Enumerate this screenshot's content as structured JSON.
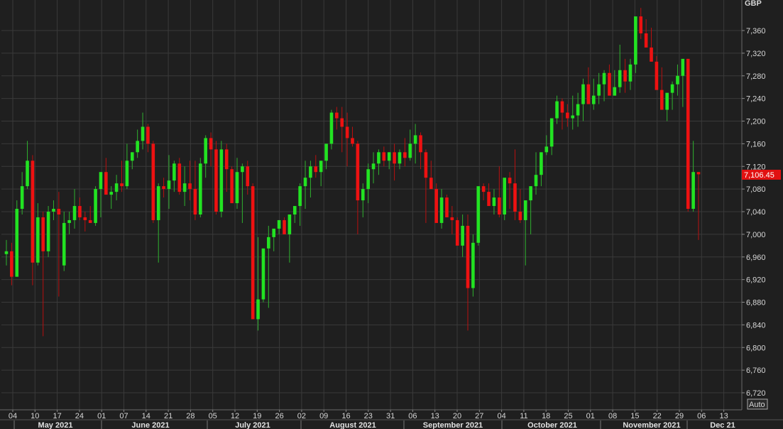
{
  "chart_data": {
    "type": "candlestick",
    "currency_label": "GBP",
    "last_price_label": "7,106.45",
    "auto_label": "Auto",
    "ylim": [
      6700,
      7400
    ],
    "y_ticks": [
      6720,
      6760,
      6800,
      6840,
      6880,
      6920,
      6960,
      7000,
      7040,
      7080,
      7120,
      7160,
      7200,
      7240,
      7280,
      7320,
      7360
    ],
    "y_tick_labels": [
      "6,720",
      "6,760",
      "6,800",
      "6,840",
      "6,880",
      "6,920",
      "6,960",
      "7,000",
      "7,040",
      "7,080",
      "7,120",
      "7,160",
      "7,200",
      "7,240",
      "7,280",
      "7,320",
      "7,360"
    ],
    "x_day_labels": [
      "04",
      "10",
      "17",
      "24",
      "01",
      "07",
      "14",
      "21",
      "28",
      "05",
      "12",
      "19",
      "26",
      "02",
      "09",
      "16",
      "23",
      "31",
      "06",
      "13",
      "20",
      "27",
      "04",
      "11",
      "18",
      "25",
      "01",
      "08",
      "15",
      "22",
      "29",
      "06",
      "13"
    ],
    "month_labels": [
      "May 2021",
      "June 2021",
      "July 2021",
      "August 2021",
      "September 2021",
      "October 2021",
      "November 2021",
      "Dec 21"
    ],
    "up_color": "#22e322",
    "down_color": "#ee1111",
    "background": "#1f1f1f",
    "candles": [
      [
        6965,
        6990,
        6945,
        6970
      ],
      [
        6970,
        6985,
        6910,
        6925
      ],
      [
        6925,
        7060,
        6925,
        7045
      ],
      [
        7045,
        7110,
        7035,
        7085
      ],
      [
        7085,
        7165,
        7080,
        7130
      ],
      [
        7130,
        7140,
        6910,
        6950
      ],
      [
        6950,
        7055,
        6945,
        7030
      ],
      [
        7030,
        7040,
        6820,
        6970
      ],
      [
        6970,
        7050,
        6960,
        7040
      ],
      [
        7040,
        7060,
        7025,
        7045
      ],
      [
        7045,
        7075,
        6890,
        7035
      ],
      [
        6945,
        7040,
        6935,
        7020
      ],
      [
        7020,
        7040,
        7000,
        7025
      ],
      [
        7025,
        7080,
        7010,
        7050
      ],
      [
        7050,
        7065,
        7025,
        7030
      ],
      [
        7030,
        7040,
        7005,
        7025
      ],
      [
        7025,
        7050,
        7020,
        7020
      ],
      [
        7020,
        7085,
        7015,
        7080
      ],
      [
        7080,
        7100,
        7030,
        7110
      ],
      [
        7110,
        7135,
        7075,
        7070
      ],
      [
        7070,
        7085,
        7045,
        7075
      ],
      [
        7075,
        7105,
        7060,
        7090
      ],
      [
        7090,
        7130,
        7075,
        7085
      ],
      [
        7085,
        7160,
        7080,
        7130
      ],
      [
        7130,
        7145,
        7115,
        7145
      ],
      [
        7145,
        7185,
        7135,
        7165
      ],
      [
        7165,
        7215,
        7150,
        7190
      ],
      [
        7190,
        7195,
        7145,
        7160
      ],
      [
        7160,
        7165,
        7020,
        7025
      ],
      [
        7025,
        7090,
        6950,
        7085
      ],
      [
        7085,
        7100,
        7065,
        7080
      ],
      [
        7080,
        7140,
        7045,
        7095
      ],
      [
        7095,
        7130,
        7075,
        7125
      ],
      [
        7125,
        7135,
        7070,
        7075
      ],
      [
        7075,
        7120,
        7050,
        7090
      ],
      [
        7090,
        7130,
        7060,
        7080
      ],
      [
        7080,
        7130,
        7025,
        7035
      ],
      [
        7035,
        7135,
        7030,
        7125
      ],
      [
        7125,
        7175,
        7100,
        7170
      ],
      [
        7170,
        7180,
        7120,
        7150
      ],
      [
        7150,
        7165,
        7035,
        7040
      ],
      [
        7040,
        7165,
        7030,
        7150
      ],
      [
        7150,
        7160,
        7075,
        7115
      ],
      [
        7115,
        7120,
        7055,
        7055
      ],
      [
        7055,
        7135,
        7045,
        7110
      ],
      [
        7110,
        7125,
        7020,
        7120
      ],
      [
        7120,
        7130,
        7070,
        7085
      ],
      [
        7085,
        7090,
        6870,
        6850
      ],
      [
        6850,
        6995,
        6830,
        6885
      ],
      [
        6885,
        6965,
        6880,
        6975
      ],
      [
        6975,
        7015,
        6870,
        6995
      ],
      [
        6995,
        7005,
        6970,
        7010
      ],
      [
        7010,
        7025,
        7000,
        7025
      ],
      [
        7025,
        7030,
        7010,
        7000
      ],
      [
        7000,
        7035,
        6950,
        7035
      ],
      [
        7035,
        7045,
        7020,
        7050
      ],
      [
        7050,
        7090,
        7015,
        7085
      ],
      [
        7085,
        7130,
        7045,
        7100
      ],
      [
        7100,
        7130,
        7065,
        7120
      ],
      [
        7120,
        7140,
        7100,
        7110
      ],
      [
        7110,
        7125,
        7085,
        7130
      ],
      [
        7130,
        7155,
        7115,
        7160
      ],
      [
        7160,
        7220,
        7150,
        7215
      ],
      [
        7215,
        7225,
        7185,
        7205
      ],
      [
        7205,
        7225,
        7145,
        7190
      ],
      [
        7190,
        7215,
        7120,
        7170
      ],
      [
        7170,
        7190,
        7155,
        7160
      ],
      [
        7160,
        7165,
        7000,
        7060
      ],
      [
        7060,
        7090,
        7030,
        7080
      ],
      [
        7080,
        7125,
        7055,
        7115
      ],
      [
        7115,
        7145,
        7090,
        7125
      ],
      [
        7125,
        7150,
        7105,
        7145
      ],
      [
        7145,
        7155,
        7120,
        7130
      ],
      [
        7130,
        7145,
        7115,
        7145
      ],
      [
        7145,
        7160,
        7095,
        7125
      ],
      [
        7125,
        7150,
        7115,
        7145
      ],
      [
        7145,
        7170,
        7120,
        7135
      ],
      [
        7135,
        7185,
        7130,
        7160
      ],
      [
        7160,
        7195,
        7125,
        7175
      ],
      [
        7175,
        7180,
        7115,
        7145
      ],
      [
        7145,
        7150,
        7020,
        7100
      ],
      [
        7100,
        7130,
        7085,
        7080
      ],
      [
        7080,
        7090,
        7020,
        7020
      ],
      [
        7020,
        7080,
        7010,
        7065
      ],
      [
        7065,
        7070,
        7030,
        7030
      ],
      [
        7030,
        7050,
        7000,
        7025
      ],
      [
        7025,
        7030,
        6985,
        6980
      ],
      [
        6980,
        7035,
        6960,
        7015
      ],
      [
        7015,
        7035,
        6830,
        6905
      ],
      [
        6905,
        7000,
        6890,
        6985
      ],
      [
        6985,
        7060,
        6980,
        7085
      ],
      [
        7085,
        7090,
        7060,
        7075
      ],
      [
        7075,
        7090,
        7060,
        7050
      ],
      [
        7050,
        7080,
        7035,
        7065
      ],
      [
        7065,
        7120,
        7030,
        7035
      ],
      [
        7035,
        7090,
        7025,
        7100
      ],
      [
        7100,
        7110,
        7045,
        7090
      ],
      [
        7090,
        7150,
        7025,
        7040
      ],
      [
        7040,
        7080,
        7020,
        7025
      ],
      [
        7025,
        7060,
        6945,
        7060
      ],
      [
        7060,
        7085,
        7000,
        7085
      ],
      [
        7085,
        7145,
        7070,
        7105
      ],
      [
        7105,
        7140,
        7085,
        7145
      ],
      [
        7145,
        7175,
        7140,
        7155
      ],
      [
        7155,
        7205,
        7140,
        7205
      ],
      [
        7205,
        7245,
        7195,
        7235
      ],
      [
        7235,
        7240,
        7185,
        7215
      ],
      [
        7215,
        7230,
        7190,
        7205
      ],
      [
        7205,
        7245,
        7185,
        7210
      ],
      [
        7210,
        7250,
        7190,
        7230
      ],
      [
        7230,
        7275,
        7200,
        7265
      ],
      [
        7265,
        7295,
        7245,
        7230
      ],
      [
        7230,
        7275,
        7220,
        7245
      ],
      [
        7245,
        7285,
        7230,
        7265
      ],
      [
        7265,
        7290,
        7235,
        7285
      ],
      [
        7285,
        7300,
        7250,
        7245
      ],
      [
        7245,
        7290,
        7245,
        7260
      ],
      [
        7260,
        7335,
        7250,
        7290
      ],
      [
        7290,
        7310,
        7250,
        7270
      ],
      [
        7270,
        7310,
        7255,
        7300
      ],
      [
        7300,
        7365,
        7285,
        7385
      ],
      [
        7385,
        7400,
        7345,
        7355
      ],
      [
        7355,
        7380,
        7335,
        7330
      ],
      [
        7330,
        7365,
        7305,
        7305
      ],
      [
        7305,
        7315,
        7265,
        7255
      ],
      [
        7255,
        7295,
        7230,
        7220
      ],
      [
        7220,
        7240,
        7200,
        7250
      ],
      [
        7250,
        7270,
        7220,
        7265
      ],
      [
        7265,
        7300,
        7245,
        7280
      ],
      [
        7280,
        7295,
        7225,
        7310
      ],
      [
        7310,
        7310,
        7040,
        7045
      ],
      [
        7045,
        7165,
        7040,
        7110
      ],
      [
        7110,
        7110,
        6990,
        7106
      ]
    ]
  }
}
